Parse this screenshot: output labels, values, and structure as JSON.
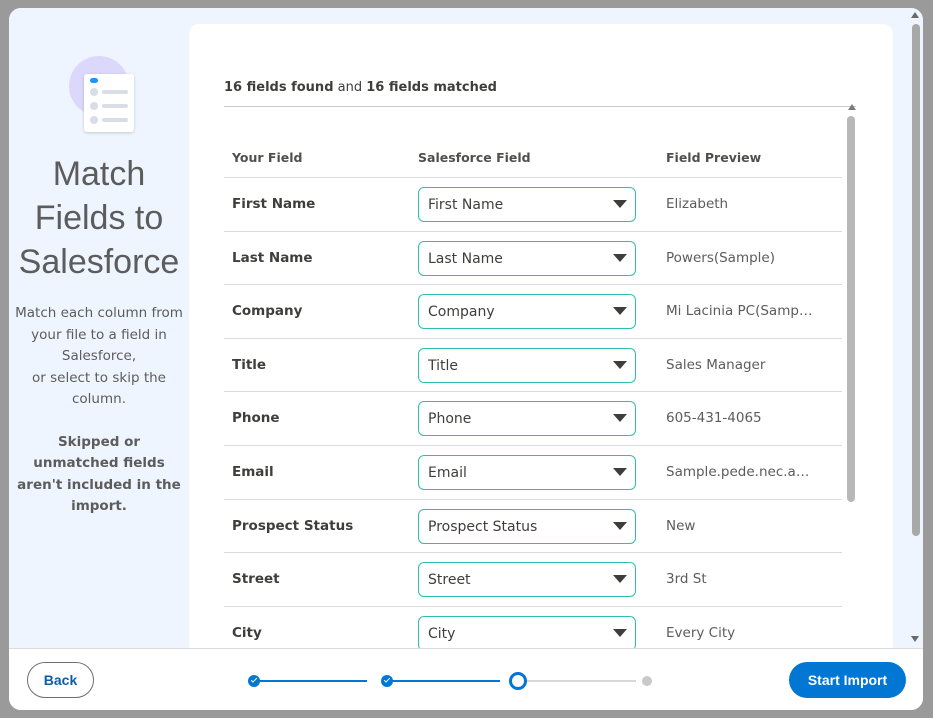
{
  "left_panel": {
    "title": "Match Fields to Salesforce",
    "description": "Match each column from your file to a field in Salesforce,",
    "description2": "or select to skip the column.",
    "note": "Skipped or unmatched fields aren't included in the import."
  },
  "summary": {
    "found_count": "16 fields found",
    "and": "and",
    "matched_count": "16 fields matched"
  },
  "table": {
    "headers": {
      "your_field": "Your Field",
      "salesforce_field": "Salesforce Field",
      "field_preview": "Field Preview"
    },
    "rows": [
      {
        "your_field": "First Name",
        "salesforce_field": "First Name",
        "preview": "Elizabeth"
      },
      {
        "your_field": "Last Name",
        "salesforce_field": "Last Name",
        "preview": "Powers(Sample)"
      },
      {
        "your_field": "Company",
        "salesforce_field": "Company",
        "preview": "Mi Lacinia PC(Sample)"
      },
      {
        "your_field": "Title",
        "salesforce_field": "Title",
        "preview": "Sales Manager"
      },
      {
        "your_field": "Phone",
        "salesforce_field": "Phone",
        "preview": "605-431-4065"
      },
      {
        "your_field": "Email",
        "salesforce_field": "Email",
        "preview": "Sample.pede.nec.ant..."
      },
      {
        "your_field": "Prospect Status",
        "salesforce_field": "Prospect Status",
        "preview": "New"
      },
      {
        "your_field": "Street",
        "salesforce_field": "Street",
        "preview": "3rd St"
      },
      {
        "your_field": "City",
        "salesforce_field": "City",
        "preview": "Every City"
      }
    ]
  },
  "footer": {
    "back_label": "Back",
    "start_label": "Start Import",
    "steps": [
      "done",
      "done",
      "current",
      "todo"
    ]
  },
  "colors": {
    "accent": "#0176d3",
    "select_border": "#2dbfb0",
    "panel_bg": "#eef5fe"
  }
}
